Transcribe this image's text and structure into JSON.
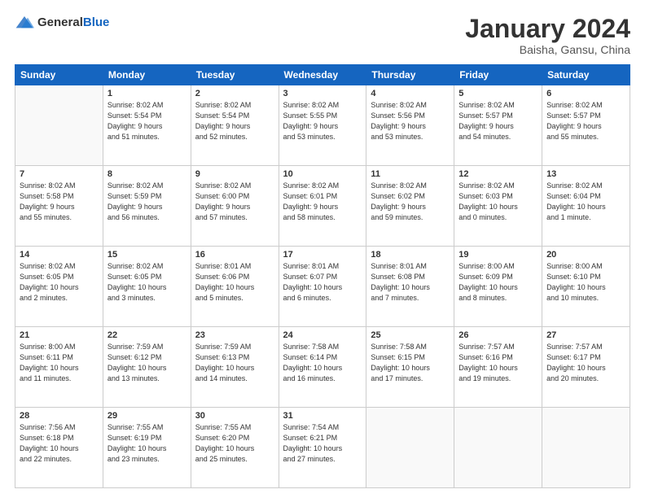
{
  "header": {
    "logo": {
      "general": "General",
      "blue": "Blue"
    },
    "title": "January 2024",
    "subtitle": "Baisha, Gansu, China"
  },
  "weekdays": [
    "Sunday",
    "Monday",
    "Tuesday",
    "Wednesday",
    "Thursday",
    "Friday",
    "Saturday"
  ],
  "weeks": [
    [
      {
        "day": "",
        "info": ""
      },
      {
        "day": "1",
        "info": "Sunrise: 8:02 AM\nSunset: 5:54 PM\nDaylight: 9 hours\nand 51 minutes."
      },
      {
        "day": "2",
        "info": "Sunrise: 8:02 AM\nSunset: 5:54 PM\nDaylight: 9 hours\nand 52 minutes."
      },
      {
        "day": "3",
        "info": "Sunrise: 8:02 AM\nSunset: 5:55 PM\nDaylight: 9 hours\nand 53 minutes."
      },
      {
        "day": "4",
        "info": "Sunrise: 8:02 AM\nSunset: 5:56 PM\nDaylight: 9 hours\nand 53 minutes."
      },
      {
        "day": "5",
        "info": "Sunrise: 8:02 AM\nSunset: 5:57 PM\nDaylight: 9 hours\nand 54 minutes."
      },
      {
        "day": "6",
        "info": "Sunrise: 8:02 AM\nSunset: 5:57 PM\nDaylight: 9 hours\nand 55 minutes."
      }
    ],
    [
      {
        "day": "7",
        "info": "Sunrise: 8:02 AM\nSunset: 5:58 PM\nDaylight: 9 hours\nand 55 minutes."
      },
      {
        "day": "8",
        "info": "Sunrise: 8:02 AM\nSunset: 5:59 PM\nDaylight: 9 hours\nand 56 minutes."
      },
      {
        "day": "9",
        "info": "Sunrise: 8:02 AM\nSunset: 6:00 PM\nDaylight: 9 hours\nand 57 minutes."
      },
      {
        "day": "10",
        "info": "Sunrise: 8:02 AM\nSunset: 6:01 PM\nDaylight: 9 hours\nand 58 minutes."
      },
      {
        "day": "11",
        "info": "Sunrise: 8:02 AM\nSunset: 6:02 PM\nDaylight: 9 hours\nand 59 minutes."
      },
      {
        "day": "12",
        "info": "Sunrise: 8:02 AM\nSunset: 6:03 PM\nDaylight: 10 hours\nand 0 minutes."
      },
      {
        "day": "13",
        "info": "Sunrise: 8:02 AM\nSunset: 6:04 PM\nDaylight: 10 hours\nand 1 minute."
      }
    ],
    [
      {
        "day": "14",
        "info": "Sunrise: 8:02 AM\nSunset: 6:05 PM\nDaylight: 10 hours\nand 2 minutes."
      },
      {
        "day": "15",
        "info": "Sunrise: 8:02 AM\nSunset: 6:05 PM\nDaylight: 10 hours\nand 3 minutes."
      },
      {
        "day": "16",
        "info": "Sunrise: 8:01 AM\nSunset: 6:06 PM\nDaylight: 10 hours\nand 5 minutes."
      },
      {
        "day": "17",
        "info": "Sunrise: 8:01 AM\nSunset: 6:07 PM\nDaylight: 10 hours\nand 6 minutes."
      },
      {
        "day": "18",
        "info": "Sunrise: 8:01 AM\nSunset: 6:08 PM\nDaylight: 10 hours\nand 7 minutes."
      },
      {
        "day": "19",
        "info": "Sunrise: 8:00 AM\nSunset: 6:09 PM\nDaylight: 10 hours\nand 8 minutes."
      },
      {
        "day": "20",
        "info": "Sunrise: 8:00 AM\nSunset: 6:10 PM\nDaylight: 10 hours\nand 10 minutes."
      }
    ],
    [
      {
        "day": "21",
        "info": "Sunrise: 8:00 AM\nSunset: 6:11 PM\nDaylight: 10 hours\nand 11 minutes."
      },
      {
        "day": "22",
        "info": "Sunrise: 7:59 AM\nSunset: 6:12 PM\nDaylight: 10 hours\nand 13 minutes."
      },
      {
        "day": "23",
        "info": "Sunrise: 7:59 AM\nSunset: 6:13 PM\nDaylight: 10 hours\nand 14 minutes."
      },
      {
        "day": "24",
        "info": "Sunrise: 7:58 AM\nSunset: 6:14 PM\nDaylight: 10 hours\nand 16 minutes."
      },
      {
        "day": "25",
        "info": "Sunrise: 7:58 AM\nSunset: 6:15 PM\nDaylight: 10 hours\nand 17 minutes."
      },
      {
        "day": "26",
        "info": "Sunrise: 7:57 AM\nSunset: 6:16 PM\nDaylight: 10 hours\nand 19 minutes."
      },
      {
        "day": "27",
        "info": "Sunrise: 7:57 AM\nSunset: 6:17 PM\nDaylight: 10 hours\nand 20 minutes."
      }
    ],
    [
      {
        "day": "28",
        "info": "Sunrise: 7:56 AM\nSunset: 6:18 PM\nDaylight: 10 hours\nand 22 minutes."
      },
      {
        "day": "29",
        "info": "Sunrise: 7:55 AM\nSunset: 6:19 PM\nDaylight: 10 hours\nand 23 minutes."
      },
      {
        "day": "30",
        "info": "Sunrise: 7:55 AM\nSunset: 6:20 PM\nDaylight: 10 hours\nand 25 minutes."
      },
      {
        "day": "31",
        "info": "Sunrise: 7:54 AM\nSunset: 6:21 PM\nDaylight: 10 hours\nand 27 minutes."
      },
      {
        "day": "",
        "info": ""
      },
      {
        "day": "",
        "info": ""
      },
      {
        "day": "",
        "info": ""
      }
    ]
  ]
}
